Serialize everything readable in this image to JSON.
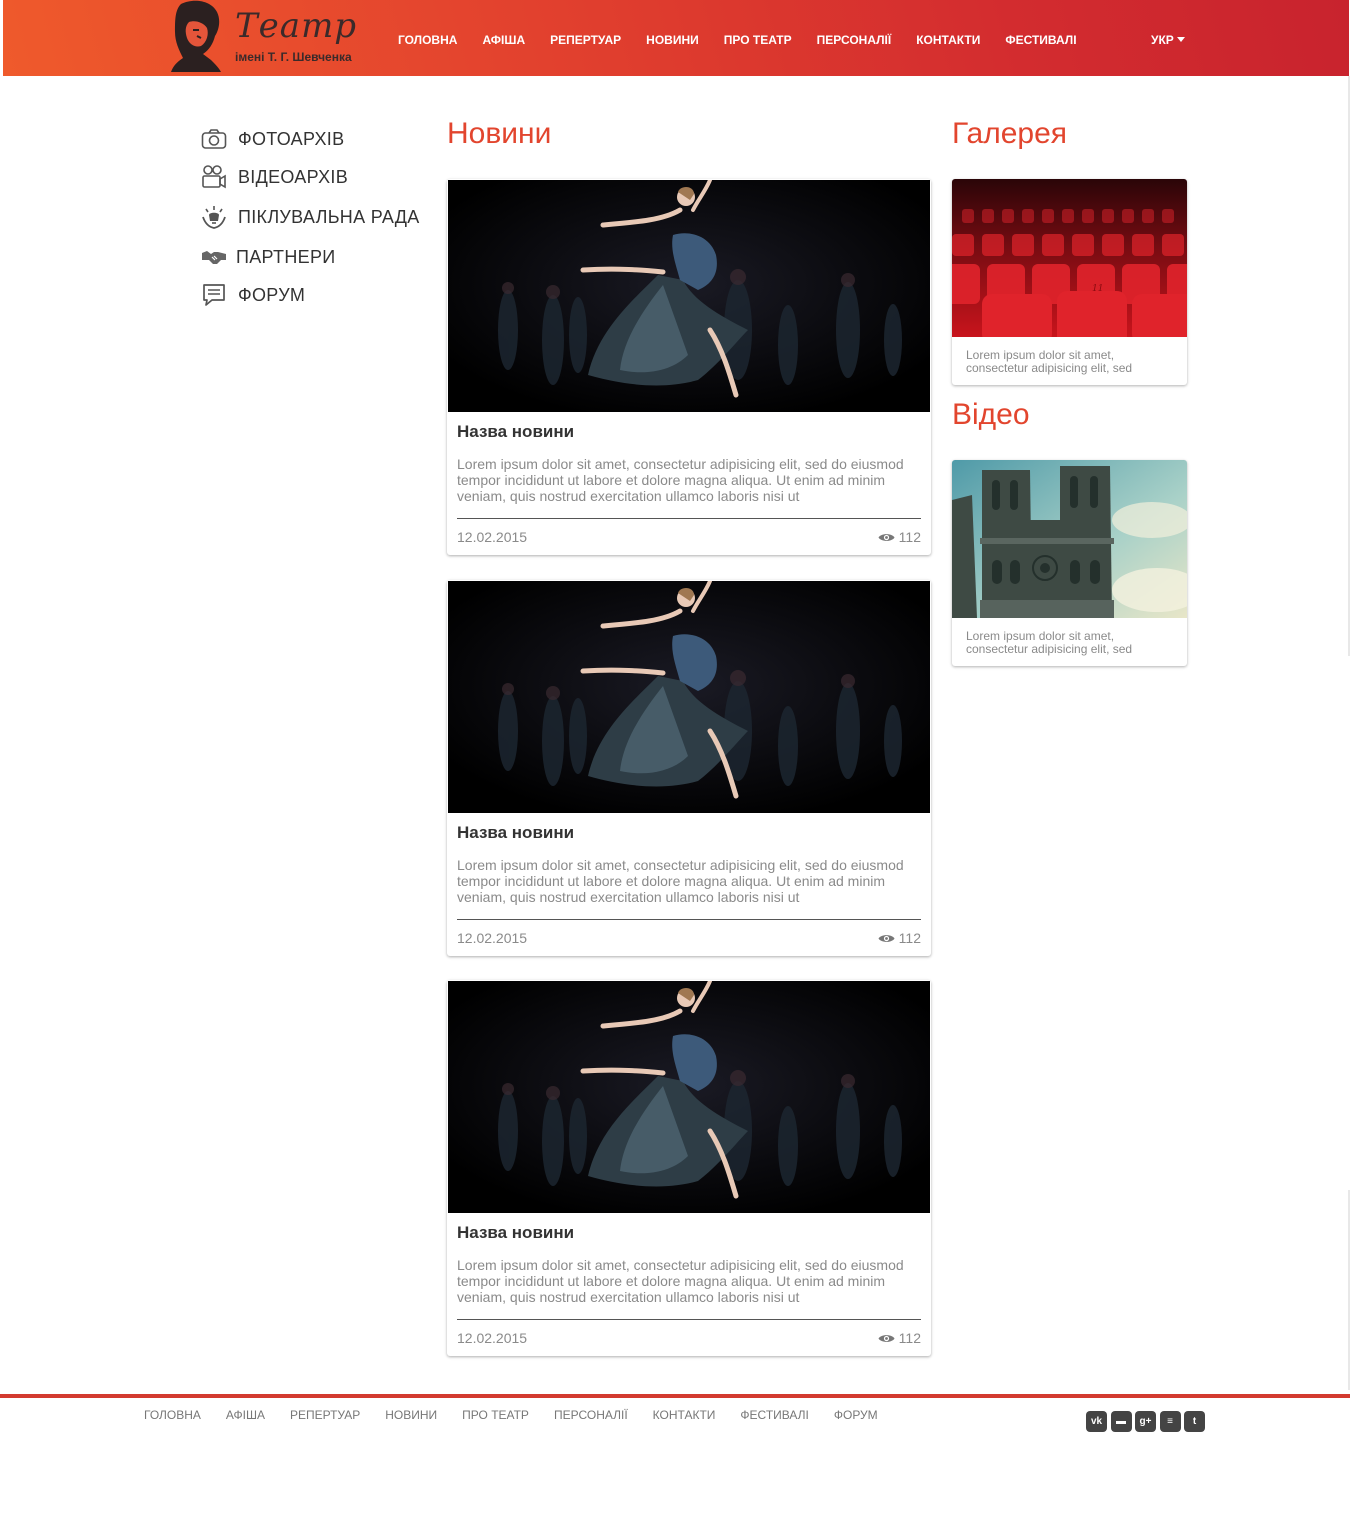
{
  "header": {
    "logo_script": "Театр",
    "logo_subtitle": "імені Т. Г. Шевченка",
    "nav": [
      "ГОЛОВНА",
      "АФІША",
      "РЕПЕРТУАР",
      "НОВИНИ",
      "ПРО ТЕАТР",
      "ПЕРСОНАЛІЇ",
      "КОНТАКТИ",
      "ФЕСТИВАЛІ"
    ],
    "language": "УКР"
  },
  "sidebar": {
    "items": [
      {
        "label": "ФОТОАРХІВ",
        "icon": "camera-icon"
      },
      {
        "label": "ВІДЕОАРХІВ",
        "icon": "video-camera-icon"
      },
      {
        "label": "ПІКЛУВАЛЬНА РАДА",
        "icon": "trustee-icon"
      },
      {
        "label": "ПАРТНЕРИ",
        "icon": "handshake-icon"
      },
      {
        "label": "ФОРУМ",
        "icon": "chat-icon"
      }
    ]
  },
  "news": {
    "title": "Новини",
    "items": [
      {
        "title": "Назва новини",
        "text": "Lorem ipsum dolor sit amet, consectetur adipisicing elit, sed do eiusmod tempor incididunt ut labore et dolore magna aliqua. Ut enim ad minim veniam, quis nostrud exercitation ullamco laboris nisi ut",
        "date": "12.02.2015",
        "views": "112"
      },
      {
        "title": "Назва новини",
        "text": "Lorem ipsum dolor sit amet, consectetur adipisicing elit, sed do eiusmod tempor incididunt ut labore et dolore magna aliqua. Ut enim ad minim veniam, quis nostrud exercitation ullamco laboris nisi ut",
        "date": "12.02.2015",
        "views": "112"
      },
      {
        "title": "Назва новини",
        "text": "Lorem ipsum dolor sit amet, consectetur adipisicing elit, sed do eiusmod tempor incididunt ut labore et dolore magna aliqua. Ut enim ad minim veniam, quis nostrud exercitation ullamco laboris nisi ut",
        "date": "12.02.2015",
        "views": "112"
      }
    ]
  },
  "gallery": {
    "title": "Галерея",
    "caption": "Lorem ipsum dolor sit amet, consectetur adipisicing elit, sed"
  },
  "video": {
    "title": "Відео",
    "caption": "Lorem ipsum dolor sit amet, consectetur adipisicing elit, sed"
  },
  "footer": {
    "nav": [
      "ГОЛОВНА",
      "АФІША",
      "РЕПЕРТУАР",
      "НОВИНИ",
      "ПРО ТЕАТР",
      "ПЕРСОНАЛІЇ",
      "КОНТАКТИ",
      "ФЕСТИВАЛІ",
      "ФОРУМ"
    ],
    "social": [
      {
        "icon": "vk-icon",
        "glyph": "vk"
      },
      {
        "icon": "youtube-icon",
        "glyph": "▬"
      },
      {
        "icon": "google-plus-icon",
        "glyph": "g+"
      },
      {
        "icon": "flag-icon",
        "glyph": "≡"
      },
      {
        "icon": "twitter-icon",
        "glyph": "t"
      }
    ]
  },
  "colors": {
    "accent": "#e2452e",
    "header_start": "#ef5a2c",
    "header_end": "#c8232e",
    "footer_line": "#d33a2f"
  }
}
